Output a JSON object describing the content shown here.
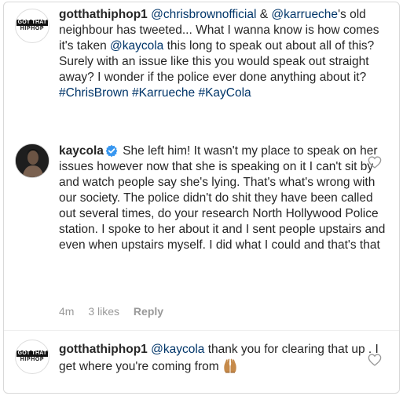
{
  "comments": [
    {
      "username": "gotthathiphop1",
      "avatar_text_top": "GOT THAT",
      "avatar_text_bottom": "HIPHOP",
      "mention1": "@chrisbrownofficial",
      "amp": " & ",
      "mention2": "@karrueche",
      "text1": "'s old neighbour has tweeted... What I wanna know is how comes it's taken ",
      "mention3": "@kaycola",
      "text2": " this long to speak out about all of this? Surely with an issue like this you would speak out straight away? I wonder if the police ever done anything about it? ",
      "hashtags": "#ChrisBrown #Karrueche #KayCola"
    },
    {
      "username": "kaycola",
      "verified_icon": "verified-badge-icon",
      "text": "She left him! It wasn't my place to speak on her issues however now that she is speaking on it I can't sit by and watch people say she's lying. That's what's wrong with our society. The police didn't do shit they have been called out several times, do your research North Hollywood Police station. I spoke to her about it and I sent people upstairs and even when upstairs myself. I did what I could and that's that",
      "time": "4m",
      "likes": "3 likes",
      "reply": "Reply"
    },
    {
      "username": "gotthathiphop1",
      "avatar_text_top": "GOT THAT",
      "avatar_text_bottom": "HIPHOP",
      "mention": "@kaycola",
      "text": " thank you for clearing that up . I get where you're coming from ",
      "emoji": "raised-hands-emoji"
    }
  ],
  "colors": {
    "text": "#262626",
    "link": "#003569",
    "meta": "#999999",
    "verified": "#3897f0"
  }
}
